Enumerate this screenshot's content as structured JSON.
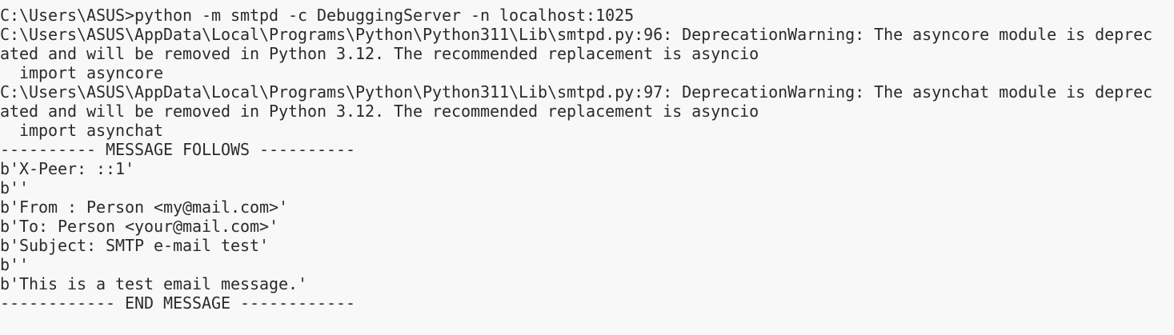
{
  "terminal": {
    "lines": [
      "C:\\Users\\ASUS>python -m smtpd -c DebuggingServer -n localhost:1025",
      "C:\\Users\\ASUS\\AppData\\Local\\Programs\\Python\\Python311\\Lib\\smtpd.py:96: DeprecationWarning: The asyncore module is deprec",
      "ated and will be removed in Python 3.12. The recommended replacement is asyncio",
      "  import asyncore",
      "C:\\Users\\ASUS\\AppData\\Local\\Programs\\Python\\Python311\\Lib\\smtpd.py:97: DeprecationWarning: The asynchat module is deprec",
      "ated and will be removed in Python 3.12. The recommended replacement is asyncio",
      "  import asynchat",
      "---------- MESSAGE FOLLOWS ----------",
      "b'X-Peer: ::1'",
      "b''",
      "b'From : Person <my@mail.com>'",
      "b'To: Person <your@mail.com>'",
      "b'Subject: SMTP e-mail test'",
      "b''",
      "b'This is a test email message.'",
      "------------ END MESSAGE ------------"
    ]
  }
}
